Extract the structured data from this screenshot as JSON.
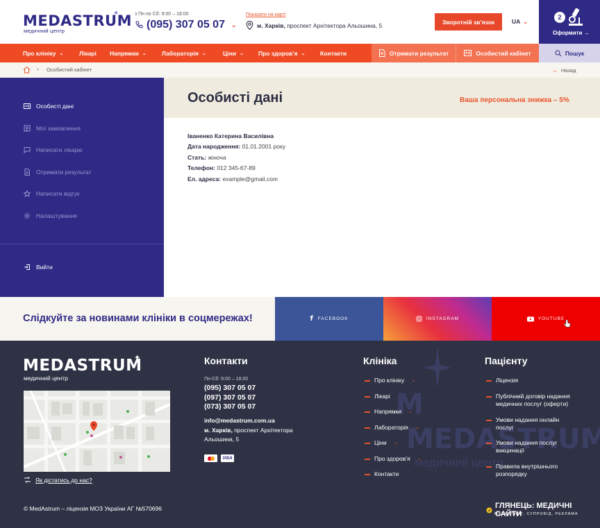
{
  "header": {
    "logo": "MEDASTRUM",
    "logo_sub": "медичний центр",
    "hours": "з Пн по Сб: 9:00 – 18:00",
    "phone": "(095) 307 05 07",
    "map_link": "Показати на карті",
    "address_city": "м. Харків,",
    "address_street": "проспект Архітектора Альошина, 5",
    "callback_label": "Зворотній зв’язок",
    "lang": "UA",
    "cart_count": "2",
    "cart_label": "Оформити"
  },
  "nav": {
    "items": [
      {
        "label": "Про клініку",
        "dropdown": true
      },
      {
        "label": "Лікарі",
        "dropdown": false
      },
      {
        "label": "Напрямки",
        "dropdown": true
      },
      {
        "label": "Лабораторія",
        "dropdown": true
      },
      {
        "label": "Ціни",
        "dropdown": true
      },
      {
        "label": "Про здоров’я",
        "dropdown": true
      },
      {
        "label": "Контакти",
        "dropdown": false
      }
    ],
    "results_label": "Отримати результат",
    "cabinet_label": "Особистий кабінет",
    "search_label": "Пошук"
  },
  "breadcrumb": {
    "current": "Особистий кабінет",
    "back": "Назад"
  },
  "sidebar": {
    "items": [
      {
        "label": "Особисті дані",
        "icon": "id-card-icon",
        "active": true
      },
      {
        "label": "Мої замовлення",
        "icon": "list-icon",
        "active": false
      },
      {
        "label": "Написати лікарю",
        "icon": "chat-icon",
        "active": false
      },
      {
        "label": "Отримати результат",
        "icon": "document-icon",
        "active": false
      },
      {
        "label": "Написати відгук",
        "icon": "star-icon",
        "active": false
      },
      {
        "label": "Налаштування",
        "icon": "gear-icon",
        "active": false
      }
    ],
    "logout": "Вийти"
  },
  "main": {
    "title": "Особисті дані",
    "discount": "Ваша персональна знижка – 5%",
    "name": "Іваненко Катерина Василівна",
    "fields": [
      {
        "label": "Дата народження:",
        "value": "01.01.2001 року"
      },
      {
        "label": "Стать:",
        "value": "жіноча"
      },
      {
        "label": "Телефон:",
        "value": "012 345-67-89"
      },
      {
        "label": "Ел. адреса:",
        "value": "example@gmail.com"
      }
    ]
  },
  "social": {
    "text": "Слідкуйте за новинами клініки в соцмережах!",
    "facebook": "FACEBOOK",
    "instagram": "INSTAGRAM",
    "youtube": "YOUTUBE"
  },
  "footer": {
    "logo": "MEDASTRUM",
    "logo_sub": "медичний центр",
    "how_to": "Як дістатись до нас?",
    "copyright": "© MedAstrum – ліцензія МОЗ України АГ №570696",
    "contacts_title": "Контакти",
    "hours": "Пн-Сб: 9:00 – 18:00",
    "phones": [
      "(095) 307 05 07",
      "(097) 307 05 07",
      "(073) 307 05 07"
    ],
    "email": "info@medastrum.com.ua",
    "address_city": "м. Харків,",
    "address_line1": "проспект Архітектора",
    "address_line2": "Альошина, 5",
    "card1": "MC",
    "card2": "VISA",
    "clinic_title": "Клініка",
    "clinic_links": [
      {
        "label": "Про клініку",
        "dropdown": true
      },
      {
        "label": "Лікарі",
        "dropdown": false
      },
      {
        "label": "Напрямки",
        "dropdown": true
      },
      {
        "label": "Лабораторія",
        "dropdown": true
      },
      {
        "label": "Ціни",
        "dropdown": true
      },
      {
        "label": "Про здоров’я",
        "dropdown": true
      },
      {
        "label": "Контакти",
        "dropdown": false
      }
    ],
    "patient_title": "Пацієнту",
    "patient_links": [
      {
        "l1": "Ліцензія",
        "l2": ""
      },
      {
        "l1": "Публічний договір надання",
        "l2": "медичних послуг (оферти)"
      },
      {
        "l1": "Умови надання онлайн",
        "l2": "послуг"
      },
      {
        "l1": "Умови надання послуг",
        "l2": "вакцинації"
      },
      {
        "l1": "Правила внутрішнього",
        "l2": "розпорядку"
      }
    ],
    "dev_name": "ГЛЯНЕЦЬ: МЕДИЧНІ САЙТИ",
    "dev_sub": "МАРКЕТИНГ, СУПРОВІД, РЕКЛАМА",
    "bg_logo": "MEDASTRUM",
    "bg_sub": "медичний центр"
  },
  "colors": {
    "brand": "#2f2a85",
    "accent": "#ef4a24",
    "footer": "#2f3245"
  }
}
